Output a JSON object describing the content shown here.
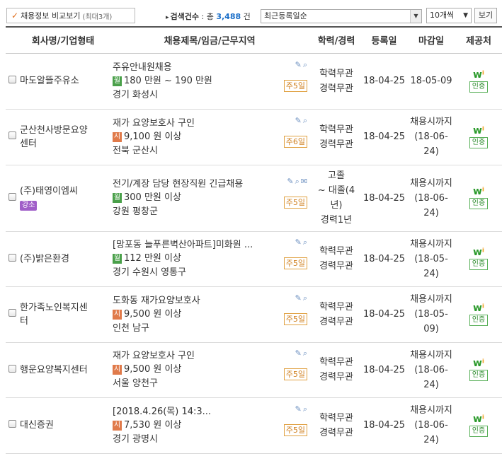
{
  "toolbar": {
    "compare_label": "채용정보 비교보기",
    "compare_sub": "(최대3개)",
    "count_label": "검색건수",
    "count_prefix": ": 총",
    "count_value": "3,488",
    "count_suffix": "건",
    "sort_value": "최근등록일순",
    "per_page_value": "10개씩",
    "view_label": "보기"
  },
  "columns": [
    "회사명/기업형태",
    "채용제목/임금/근무지역",
    "학력/경력",
    "등록일",
    "마감일",
    "제공처"
  ],
  "rows": [
    {
      "company": [
        "마도알뜰주유소"
      ],
      "badge": "",
      "title": "주유안내원채용",
      "pay_type": "월",
      "pay": "180 만원 ~ 190 만원",
      "location": "경기 화성시",
      "remaining": "주5일",
      "education": [
        "학력무관",
        "경력무관"
      ],
      "registered": "18-04-25",
      "deadline": [
        "18-05-09"
      ],
      "provider": "인증"
    },
    {
      "company": [
        "군산천사방문요양",
        "센터"
      ],
      "badge": "",
      "title": "재가 요양보호사 구인",
      "pay_type": "시",
      "pay": "9,100 원 이상",
      "location": "전북 군산시",
      "remaining": "주6일",
      "education": [
        "학력무관",
        "경력무관"
      ],
      "registered": "18-04-25",
      "deadline": [
        "채용시까지",
        "(18-06-",
        "24)"
      ],
      "provider": "인증"
    },
    {
      "company": [
        "(주)태영이엠씨"
      ],
      "badge": "강소",
      "title": "전기/계장 담당 현장직원 긴급채용",
      "pay_type": "월",
      "pay": "300 만원 이상",
      "location": "강원 평창군",
      "remaining": "주5일",
      "education": [
        "고졸",
        "~ 대졸(4",
        "년)",
        "경력1년"
      ],
      "registered": "18-04-25",
      "deadline": [
        "채용시까지",
        "(18-06-",
        "24)"
      ],
      "provider": "인증"
    },
    {
      "company": [
        "(주)밝은환경"
      ],
      "badge": "",
      "title": "[망포동 늘푸른벽산아파트]미화원 ...",
      "pay_type": "월",
      "pay": "112 만원 이상",
      "location": "경기 수원시 영통구",
      "remaining": "주5일",
      "education": [
        "학력무관",
        "경력무관"
      ],
      "registered": "18-04-25",
      "deadline": [
        "채용시까지",
        "(18-05-",
        "24)"
      ],
      "provider": "인증"
    },
    {
      "company": [
        "한가족노인복지센",
        "터"
      ],
      "badge": "",
      "title": "도화동 재가요양보호사",
      "pay_type": "시",
      "pay": "9,500 원 이상",
      "location": "인천 남구",
      "remaining": "주5일",
      "education": [
        "학력무관",
        "경력무관"
      ],
      "registered": "18-04-25",
      "deadline": [
        "채용시까지",
        "(18-05-",
        "09)"
      ],
      "provider": "인증"
    },
    {
      "company": [
        "행운요양복지센터"
      ],
      "badge": "",
      "title": "재가 요양보호사 구인",
      "pay_type": "시",
      "pay": "9,500 원 이상",
      "location": "서울 양천구",
      "remaining": "주5일",
      "education": [
        "학력무관",
        "경력무관"
      ],
      "registered": "18-04-25",
      "deadline": [
        "채용시까지",
        "(18-06-",
        "24)"
      ],
      "provider": "인증"
    },
    {
      "company": [
        "대신증권"
      ],
      "badge": "",
      "title": "[2018.4.26(목) 14:3...",
      "pay_type": "시",
      "pay": "7,530 원 이상",
      "location": "경기 광명시",
      "remaining": "주5일",
      "education": [
        "학력무관",
        "경력무관"
      ],
      "registered": "18-04-25",
      "deadline": [
        "채용시까지",
        "(18-06-",
        "24)"
      ],
      "provider": "인증"
    }
  ],
  "row_heights": [],
  "icons": {
    "edit": "edit-icon",
    "search": "search-icon",
    "mail": "mail-icon",
    "provider_logo": "worknet-logo-icon"
  }
}
